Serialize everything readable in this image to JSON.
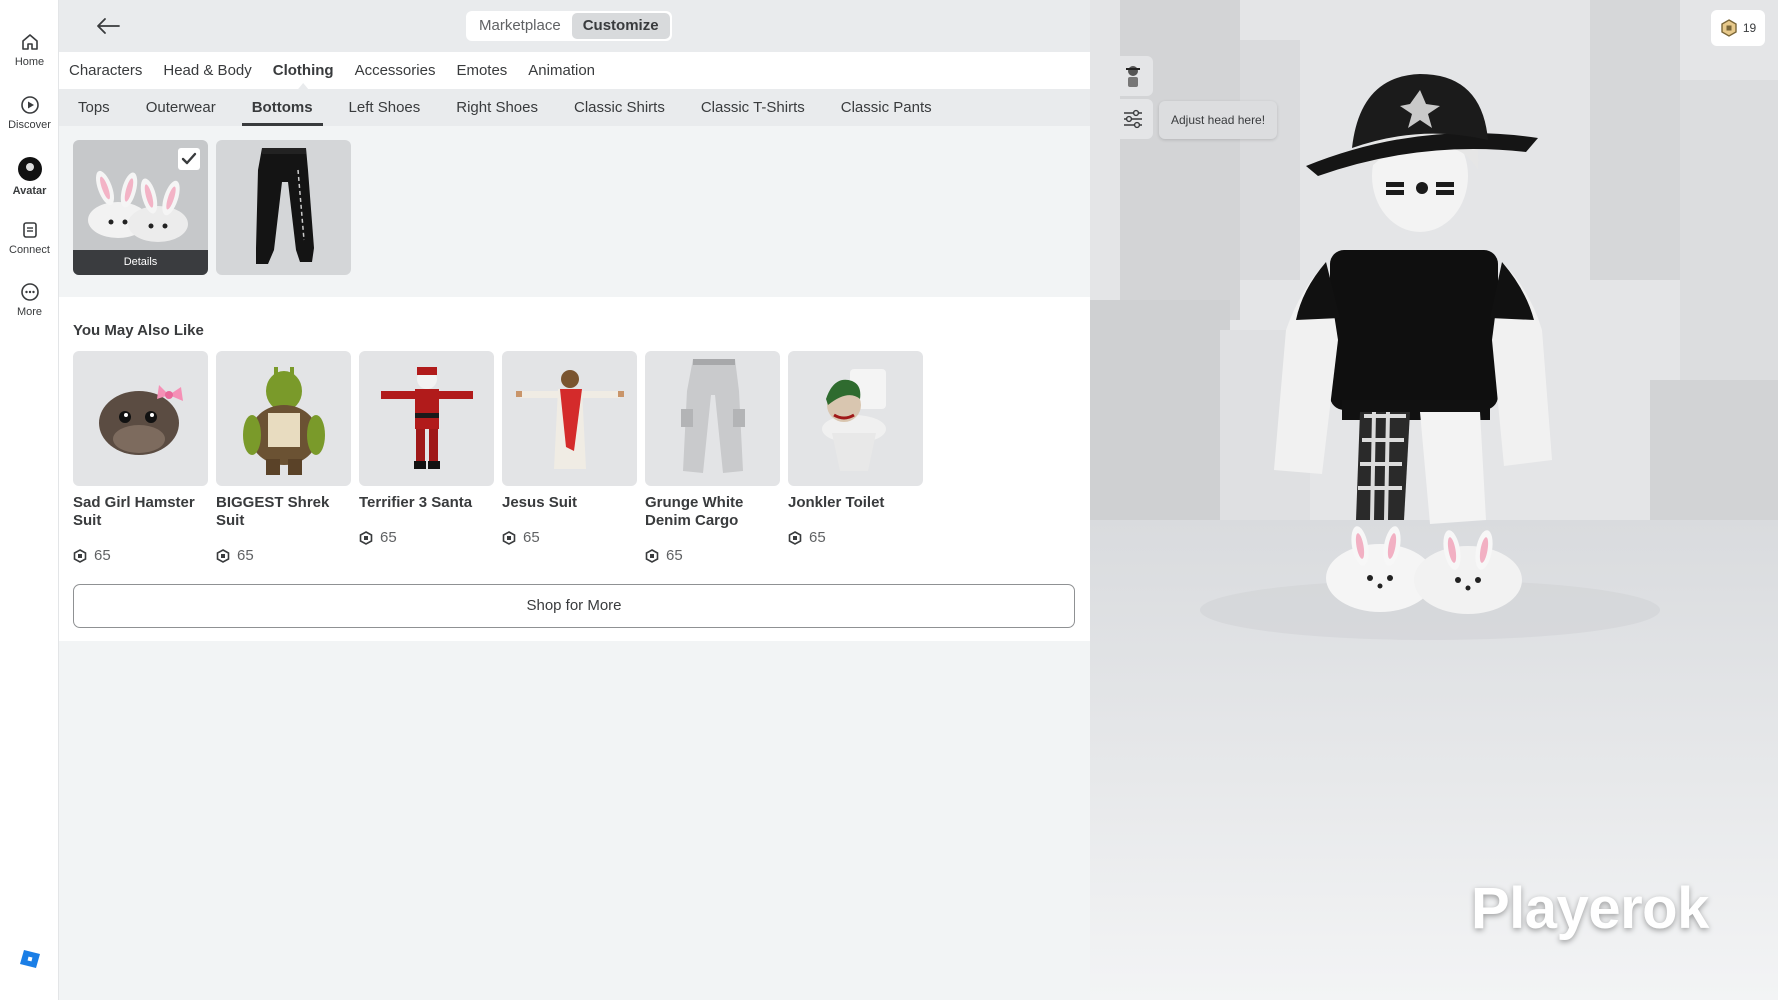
{
  "nav": {
    "items": [
      {
        "label": "Home",
        "icon": "home-icon"
      },
      {
        "label": "Discover",
        "icon": "play-circle-icon"
      },
      {
        "label": "Avatar",
        "icon": "avatar-icon"
      },
      {
        "label": "Connect",
        "icon": "chat-icon"
      },
      {
        "label": "More",
        "icon": "more-icon"
      }
    ]
  },
  "top": {
    "marketplace": "Marketplace",
    "customize": "Customize"
  },
  "categories": [
    "Characters",
    "Head & Body",
    "Clothing",
    "Accessories",
    "Emotes",
    "Animation"
  ],
  "active_category": "Clothing",
  "subcategories": [
    "Tops",
    "Outerwear",
    "Bottoms",
    "Left Shoes",
    "Right Shoes",
    "Classic Shirts",
    "Classic T-Shirts",
    "Classic Pants"
  ],
  "active_subcategory": "Bottoms",
  "owned": {
    "details_label": "Details"
  },
  "recommend": {
    "title": "You May Also Like",
    "items": [
      {
        "name": "Sad Girl Hamster Suit",
        "price": "65"
      },
      {
        "name": "BIGGEST Shrek Suit",
        "price": "65"
      },
      {
        "name": "Terrifier 3 Santa",
        "price": "65"
      },
      {
        "name": "Jesus Suit",
        "price": "65"
      },
      {
        "name": "Grunge White Denim Cargo",
        "price": "65"
      },
      {
        "name": "Jonkler Toilet",
        "price": "65"
      }
    ],
    "shop_more": "Shop for More"
  },
  "viewport": {
    "tooltip": "Adjust head here!",
    "robux_balance": "19",
    "watermark": "Playerok"
  },
  "colors": {
    "brand_blue": "#1a7ee6",
    "selected_tab_underline": "#393b3d"
  }
}
